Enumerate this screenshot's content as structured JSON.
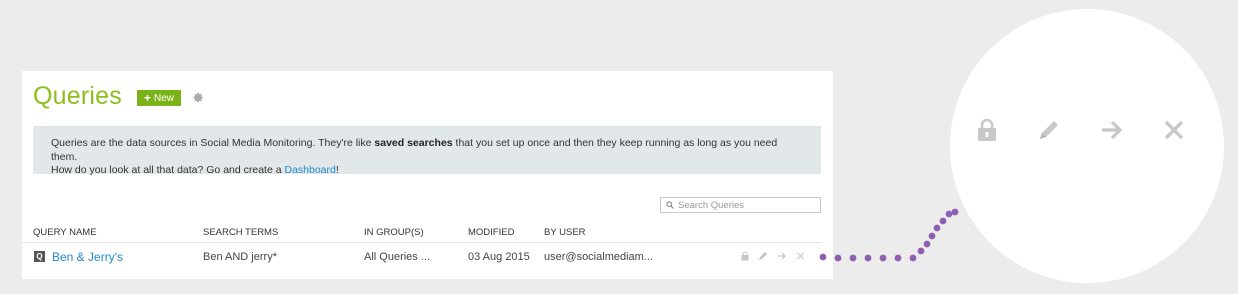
{
  "header": {
    "title": "Queries",
    "new_button_label": "New",
    "settings_icon": "gear-icon"
  },
  "info": {
    "text_1": "Queries are the data sources in Social Media Monitoring. They're like ",
    "text_bold": "saved searches",
    "text_2": " that you set up once and then they keep running as long as you need them.",
    "text_3": "How do you look at all that data? Go and create a ",
    "link": "Dashboard",
    "text_4": "!"
  },
  "search": {
    "placeholder": "Search Queries"
  },
  "table": {
    "columns": [
      "QUERY NAME",
      "SEARCH TERMS",
      "IN GROUP(S)",
      "MODIFIED",
      "BY USER"
    ],
    "rows": [
      {
        "icon_label": "Q",
        "name": "Ben & Jerry's",
        "search_terms": "Ben AND jerry*",
        "groups": "All Queries ...",
        "modified": "03 Aug 2015",
        "user": "user@socialmediam..."
      }
    ]
  },
  "row_actions": [
    "lock-icon",
    "pencil-icon",
    "arrow-right-icon",
    "close-icon"
  ],
  "colors": {
    "title_green": "#8cbe1e",
    "button_green": "#7ab317",
    "link_blue": "#1d8acc",
    "info_bg": "#e2e8e9",
    "dot_purple": "#8f5fb2",
    "icon_grey": "#c5c5c5"
  }
}
